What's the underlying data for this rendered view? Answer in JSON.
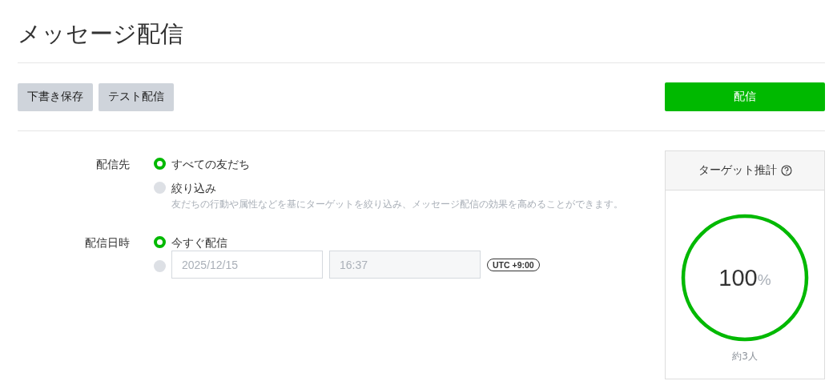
{
  "title": "メッセージ配信",
  "toolbar": {
    "buttons": [
      {
        "label": "下書き保存"
      },
      {
        "label": "テスト配信"
      }
    ],
    "primary_button": {
      "label": "配信"
    }
  },
  "form": [
    {
      "label": "配信先",
      "options": [
        {
          "kind": "text",
          "label": "すべての友だち",
          "selected": true
        },
        {
          "kind": "text",
          "label": "絞り込み",
          "selected": false,
          "description": "友だちの行動や属性などを基にターゲットを絞り込み、メッセージ配信の効果を高めることができます。"
        }
      ]
    },
    {
      "label": "配信日時",
      "options": [
        {
          "kind": "text",
          "label": "今すぐ配信",
          "selected": true
        },
        {
          "kind": "datetime",
          "selected": false,
          "date": "2025/12/15",
          "time": "16:37",
          "timezone": "UTC +9:00"
        }
      ]
    }
  ],
  "target_card": {
    "title": "ターゲット推計",
    "level": 1,
    "value": "100",
    "unit": "%",
    "count": "約3人"
  }
}
